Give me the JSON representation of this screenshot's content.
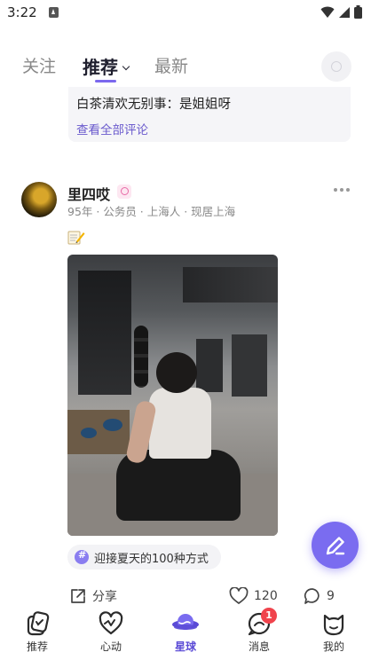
{
  "status_bar": {
    "time": "3:22"
  },
  "tabs": {
    "follow": "关注",
    "recommend": "推荐",
    "latest": "最新"
  },
  "comment_preview": {
    "text": "白茶清欢无别事：是姐姐呀",
    "view_all": "查看全部评论"
  },
  "post": {
    "author": "里四哎",
    "meta": "95年 · 公务员 · 上海人 · 现居上海",
    "topic": "迎接夏天的100种方式",
    "share_label": "分享",
    "likes": "120",
    "comments": "9"
  },
  "nav": {
    "items": [
      {
        "label": "推荐"
      },
      {
        "label": "心动"
      },
      {
        "label": "星球"
      },
      {
        "label": "消息"
      },
      {
        "label": "我的"
      }
    ],
    "message_badge": "1"
  },
  "colors": {
    "accent": "#7b68ee",
    "badge": "#f0434c"
  }
}
